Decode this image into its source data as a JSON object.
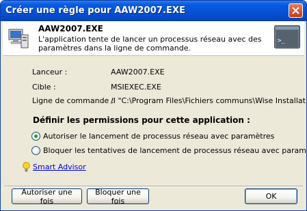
{
  "window": {
    "title": "Créer une règle pour AAW2007.EXE"
  },
  "header": {
    "app_name": "AAW2007.EXE",
    "description": "L'application tente de lancer un processus réseau avec des paramètres dans la ligne de commande."
  },
  "details": [
    {
      "label": "Lanceur :",
      "value": "AAW2007.EXE"
    },
    {
      "label": "Cible :",
      "value": "MSIEXEC.EXE"
    },
    {
      "label": "Ligne de commande :",
      "value": "/I \"C:\\Program Files\\Fichiers communs\\Wise Installatio..."
    }
  ],
  "permissions": {
    "title": "Définir les permissions pour cette application :",
    "options": [
      {
        "label": "Autoriser le lancement de processus réseau avec paramètres",
        "selected": true
      },
      {
        "label": "Bloquer les tentatives de lancement de processus réseau avec paramètres",
        "selected": false
      }
    ]
  },
  "advisor": {
    "label": "Smart Advisor",
    "icon": "lightbulb-icon"
  },
  "buttons": {
    "allow_once": "Autoriser une fois",
    "block_once": "Bloquer une fois",
    "ok": "OK"
  },
  "colors": {
    "titlebar": "#0553d6",
    "selected_radio": "#21a121",
    "link": "#0000ee"
  }
}
